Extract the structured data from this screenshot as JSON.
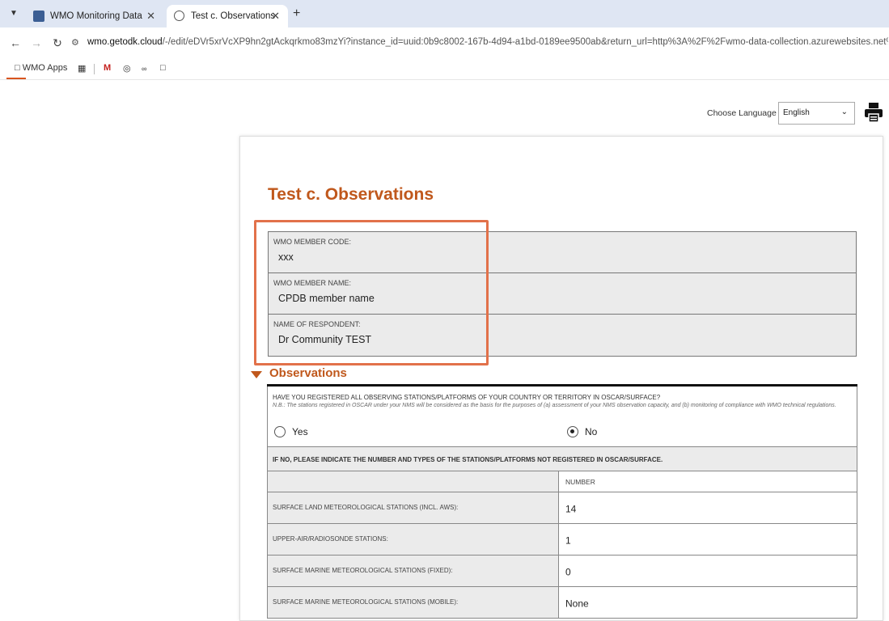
{
  "browser": {
    "tabs": [
      {
        "title": "WMO Monitoring Data Collecti",
        "active": false
      },
      {
        "title": "Test c. Observations",
        "active": true
      }
    ],
    "url_prefix": "wmo.getodk.cloud",
    "url_rest": "/-/edit/eDVr5xrVcXP9hn2gtAckqrkmo83mzYi?instance_id=uuid:0b9c8002-167b-4d94-a1bd-0189ee9500ab&return_url=http%3A%2F%2Fwmo-data-collection.azurewebsites.net%2Fthank_you%2Ftest_c_",
    "bookmarks": {
      "wmo_apps": "WMO Apps"
    }
  },
  "language": {
    "label": "Choose Language",
    "selected": "English"
  },
  "form": {
    "title": "Test c. Observations",
    "member_code": {
      "label": "WMO MEMBER CODE:",
      "value": "xxx"
    },
    "member_name": {
      "label": "WMO MEMBER NAME:",
      "value": "CPDB member name"
    },
    "respondent": {
      "label": "NAME OF RESPONDENT:",
      "value": "Dr Community TEST"
    }
  },
  "observations": {
    "section_title": "Observations",
    "question": "HAVE YOU REGISTERED ALL OBSERVING STATIONS/PLATFORMS OF YOUR COUNTRY OR TERRITORY IN OSCAR/SURFACE?",
    "hint": "N.B.: The stations registered in OSCAR under your NMS will be considered as the basis for the purposes of (a) assessment of your NMS observation capacity, and (b) monitoring of compliance with WMO technical regulations.",
    "options": {
      "yes": "Yes",
      "no": "No"
    },
    "selected": "No",
    "if_no_label": "IF NO, PLEASE INDICATE THE NUMBER AND TYPES OF THE STATIONS/PLATFORMS NOT REGISTERED IN OSCAR/SURFACE.",
    "number_header": "NUMBER",
    "rows": [
      {
        "label": "SURFACE LAND METEOROLOGICAL STATIONS (INCL. AWS):",
        "value": "14"
      },
      {
        "label": "UPPER-AIR/RADIOSONDE STATIONS:",
        "value": "1"
      },
      {
        "label": "SURFACE MARINE METEOROLOGICAL STATIONS (FIXED):",
        "value": "0"
      },
      {
        "label": "SURFACE MARINE METEOROLOGICAL STATIONS (MOBILE):",
        "value": "None"
      }
    ]
  }
}
